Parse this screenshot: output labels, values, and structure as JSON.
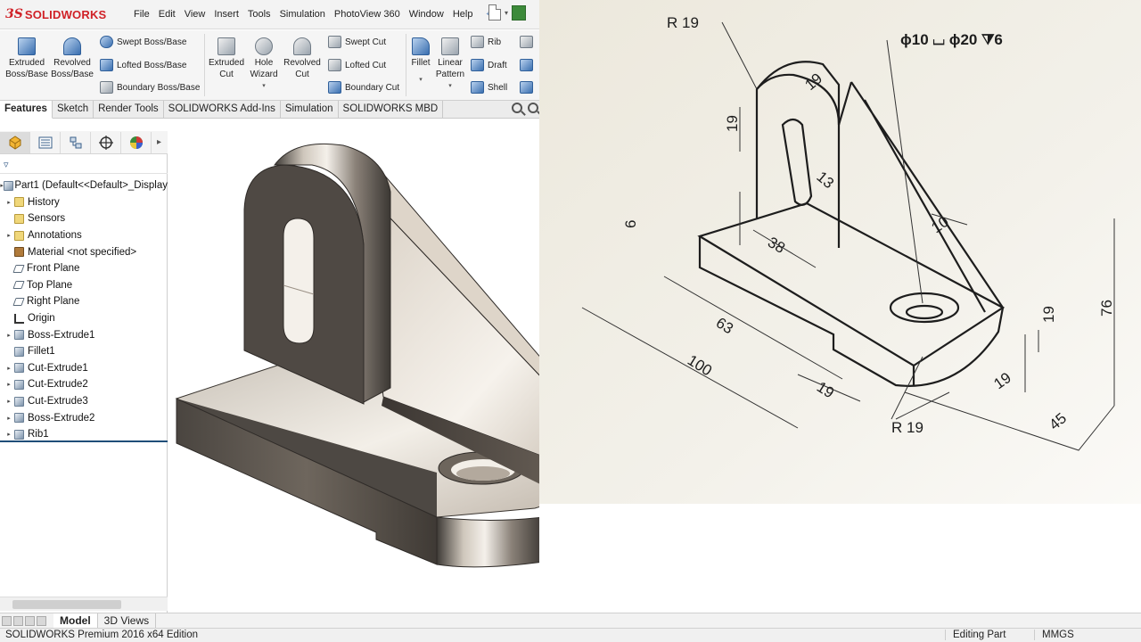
{
  "app": {
    "logo_ds": "3S",
    "logo_name": "SOLIDWORKS",
    "menus": [
      "File",
      "Edit",
      "View",
      "Insert",
      "Tools",
      "Simulation",
      "PhotoView 360",
      "Window",
      "Help"
    ]
  },
  "ribbon": {
    "extruded_boss": [
      "Extruded",
      "Boss/Base"
    ],
    "revolved_boss": [
      "Revolved",
      "Boss/Base"
    ],
    "swept_boss": "Swept Boss/Base",
    "lofted_boss": "Lofted Boss/Base",
    "boundary_boss": "Boundary Boss/Base",
    "extruded_cut": [
      "Extruded",
      "Cut"
    ],
    "hole_wizard": [
      "Hole",
      "Wizard"
    ],
    "revolved_cut": [
      "Revolved",
      "Cut"
    ],
    "swept_cut": "Swept Cut",
    "lofted_cut": "Lofted Cut",
    "boundary_cut": "Boundary Cut",
    "fillet": "Fillet",
    "linear_pattern": [
      "Linear",
      "Pattern"
    ],
    "rib": "Rib",
    "draft": "Draft",
    "shell": "Shell"
  },
  "tabs": [
    "Features",
    "Sketch",
    "Render Tools",
    "SOLIDWORKS Add-Ins",
    "Simulation",
    "SOLIDWORKS MBD"
  ],
  "tree": {
    "root": "Part1  (Default<<Default>_Display",
    "items": [
      {
        "label": "History",
        "icon": "folder"
      },
      {
        "label": "Sensors",
        "icon": "folder"
      },
      {
        "label": "Annotations",
        "icon": "folder"
      },
      {
        "label": "Material <not specified>",
        "icon": "material"
      },
      {
        "label": "Front Plane",
        "icon": "plane"
      },
      {
        "label": "Top Plane",
        "icon": "plane"
      },
      {
        "label": "Right Plane",
        "icon": "plane"
      },
      {
        "label": "Origin",
        "icon": "origin"
      },
      {
        "label": "Boss-Extrude1",
        "icon": "feature"
      },
      {
        "label": "Fillet1",
        "icon": "feature"
      },
      {
        "label": "Cut-Extrude1",
        "icon": "feature"
      },
      {
        "label": "Cut-Extrude2",
        "icon": "feature"
      },
      {
        "label": "Cut-Extrude3",
        "icon": "feature"
      },
      {
        "label": "Boss-Extrude2",
        "icon": "feature"
      },
      {
        "label": "Rib1",
        "icon": "feature"
      }
    ]
  },
  "model_tabs": [
    "Model",
    "3D Views"
  ],
  "status": {
    "edition": "SOLIDWORKS Premium 2016 x64 Edition",
    "mode": "Editing Part",
    "units": "MMGS"
  },
  "drawing": {
    "dims": {
      "r19_top": "R 19",
      "hole_callout": "ɸ10 ⌴ ɸ20 ⧩6",
      "d19_top": "19",
      "d19_left": "19",
      "d13": "13",
      "d6": "6",
      "d38": "38",
      "d10": "10",
      "d63": "63",
      "d100": "100",
      "d19_base_left": "19",
      "r19_bottom": "R 19",
      "d19_base_right": "19",
      "d19_right": "19",
      "d76": "76",
      "d45": "45"
    }
  }
}
